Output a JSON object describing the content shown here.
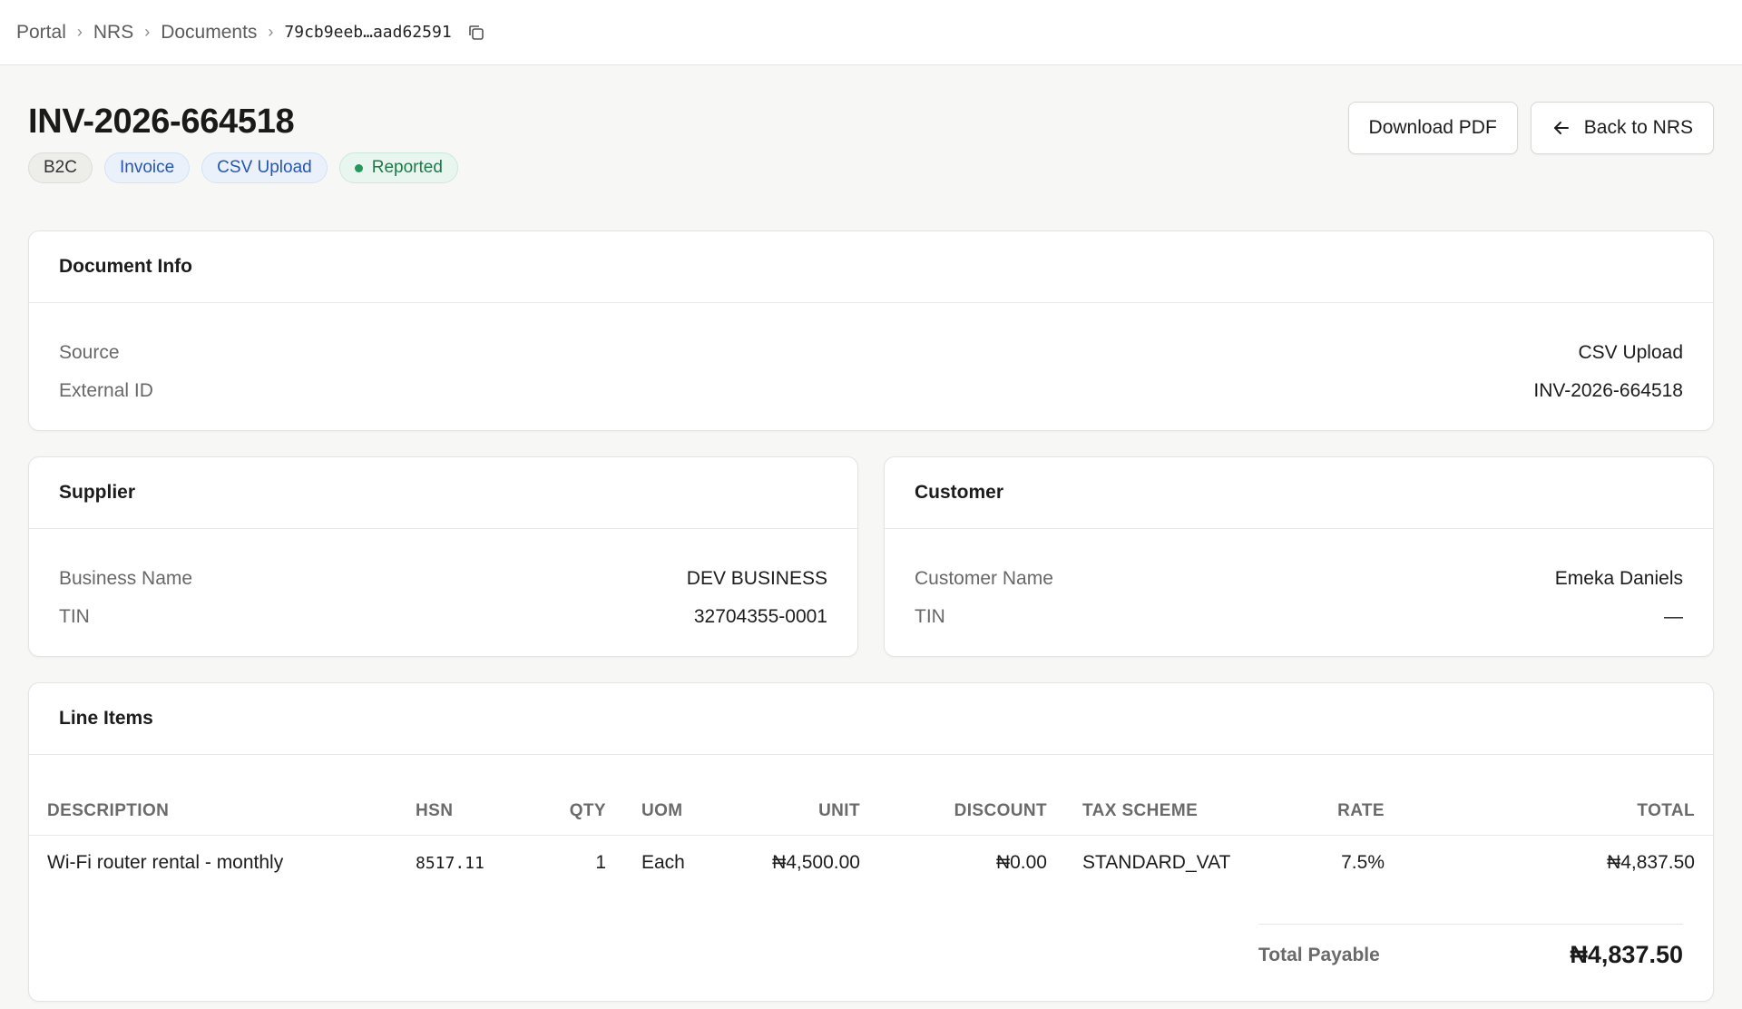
{
  "breadcrumb": {
    "items": [
      "Portal",
      "NRS",
      "Documents"
    ],
    "current": "79cb9eeb…aad62591"
  },
  "header": {
    "title": "INV-2026-664518",
    "badges": {
      "type": "B2C",
      "doc_kind": "Invoice",
      "source": "CSV Upload",
      "status": "Reported"
    },
    "actions": {
      "download": "Download PDF",
      "back": "Back to NRS"
    }
  },
  "document_info": {
    "title": "Document Info",
    "rows": [
      {
        "label": "Source",
        "value": "CSV Upload"
      },
      {
        "label": "External ID",
        "value": "INV-2026-664518"
      }
    ]
  },
  "supplier": {
    "title": "Supplier",
    "rows": [
      {
        "label": "Business Name",
        "value": "DEV BUSINESS"
      },
      {
        "label": "TIN",
        "value": "32704355-0001"
      }
    ]
  },
  "customer": {
    "title": "Customer",
    "rows": [
      {
        "label": "Customer Name",
        "value": "Emeka Daniels"
      },
      {
        "label": "TIN",
        "value": "—"
      }
    ]
  },
  "line_items": {
    "title": "Line Items",
    "columns": [
      "Description",
      "HSN",
      "Qty",
      "UOM",
      "Unit",
      "Discount",
      "Tax Scheme",
      "Rate",
      "Total"
    ],
    "rows": [
      {
        "description": "Wi-Fi router rental - monthly",
        "hsn": "8517.11",
        "qty": "1",
        "uom": "Each",
        "unit": "₦4,500.00",
        "discount": "₦0.00",
        "tax_scheme": "STANDARD_VAT",
        "rate": "7.5%",
        "total": "₦4,837.50"
      }
    ],
    "total_label": "Total Payable",
    "total_value": "₦4,837.50"
  },
  "colors": {
    "accent_blue": "#2456b6",
    "status_green": "#1f7a4a",
    "background": "#f7f7f6"
  }
}
